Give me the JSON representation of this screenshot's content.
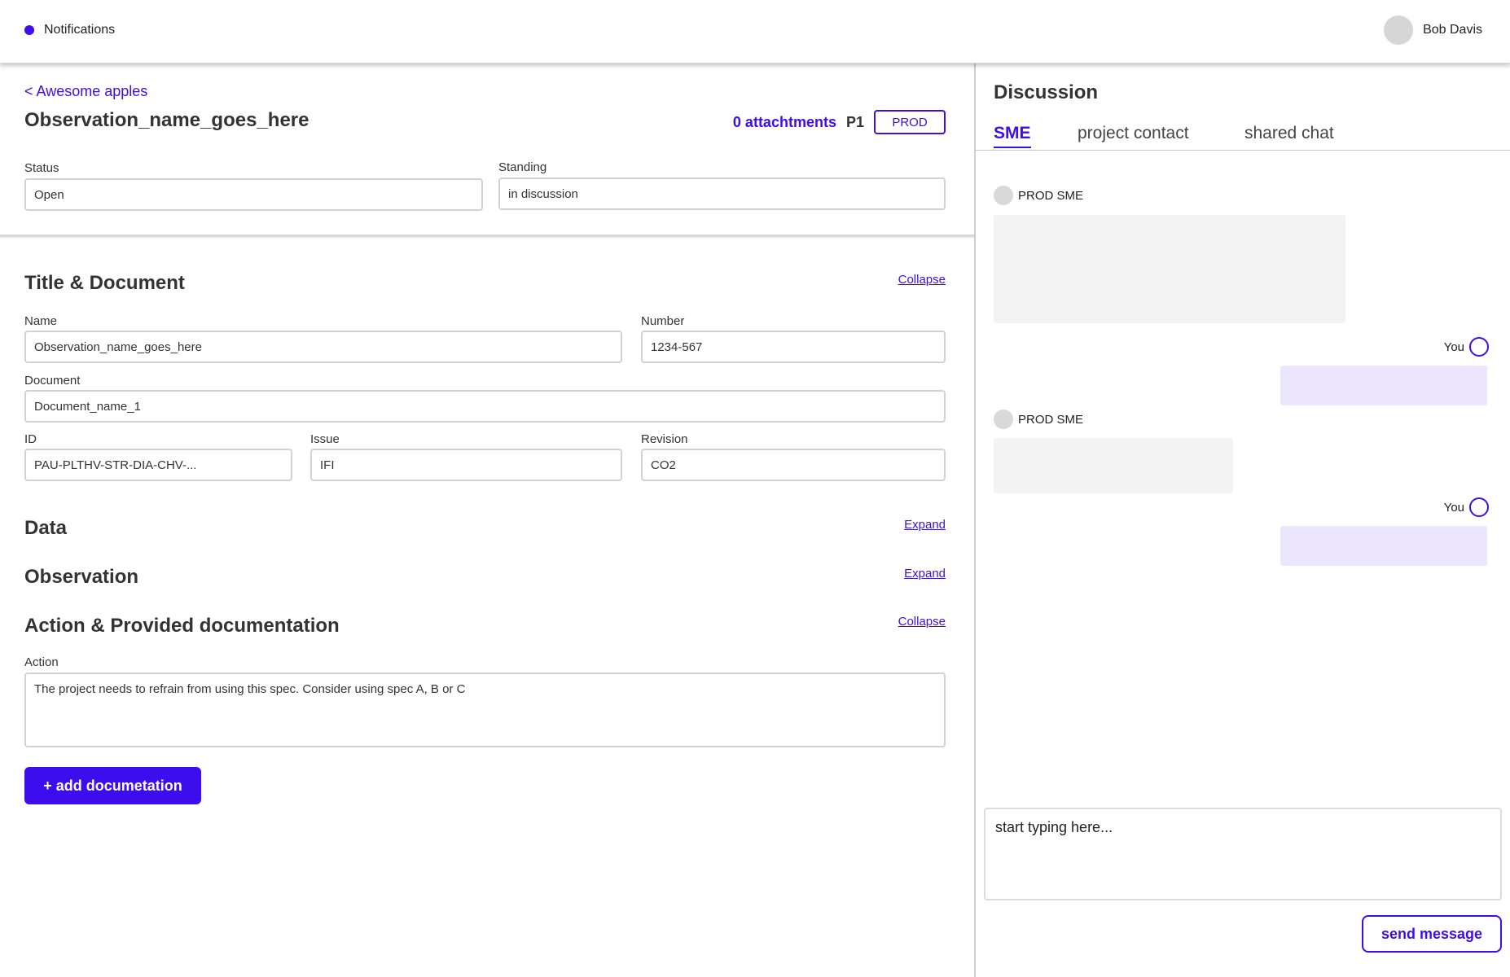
{
  "topbar": {
    "notifications_label": "Notifications",
    "user_name": "Bob Davis"
  },
  "observation": {
    "back_link": "< Awesome apples",
    "title": "Observation_name_goes_here",
    "attachments": "0 attachtments",
    "priority": "P1",
    "env_badge": "PROD",
    "status_label": "Status",
    "status_value": "Open",
    "standing_label": "Standing",
    "standing_value": "in discussion"
  },
  "title_document": {
    "heading": "Title & Document",
    "toggle": "Collapse",
    "name_label": "Name",
    "name_value": "Observation_name_goes_here",
    "number_label": "Number",
    "number_value": "1234-567",
    "document_label": "Document",
    "document_value": "Document_name_1",
    "id_label": "ID",
    "id_value": "PAU-PLTHV-STR-DIA-CHV-...",
    "issue_label": "Issue",
    "issue_value": "IFI",
    "revision_label": "Revision",
    "revision_value": "CO2"
  },
  "data_section": {
    "heading": "Data",
    "toggle": "Expand"
  },
  "observation_section": {
    "heading": "Observation",
    "toggle": "Expand"
  },
  "action_section": {
    "heading": "Action &  Provided documentation",
    "toggle": "Collapse",
    "action_label": "Action",
    "action_value": "The project needs to refrain from using this spec. Consider using spec A, B or C",
    "add_button": "+ add documetation"
  },
  "discussion": {
    "title": "Discussion",
    "tabs": [
      {
        "label": "SME",
        "active": true
      },
      {
        "label": "project contact",
        "active": false
      },
      {
        "label": "shared chat",
        "active": false
      }
    ],
    "messages": [
      {
        "sender": "PROD SME",
        "side": "left"
      },
      {
        "sender": "You",
        "side": "right"
      },
      {
        "sender": "PROD SME",
        "side": "left"
      },
      {
        "sender": "You",
        "side": "right"
      }
    ],
    "compose_placeholder": "start typing here...",
    "send_button": "send message"
  },
  "colors": {
    "accent": "#3d0ded",
    "bubble_grey": "#f3f3f3",
    "bubble_purple": "#ebe6fe"
  }
}
